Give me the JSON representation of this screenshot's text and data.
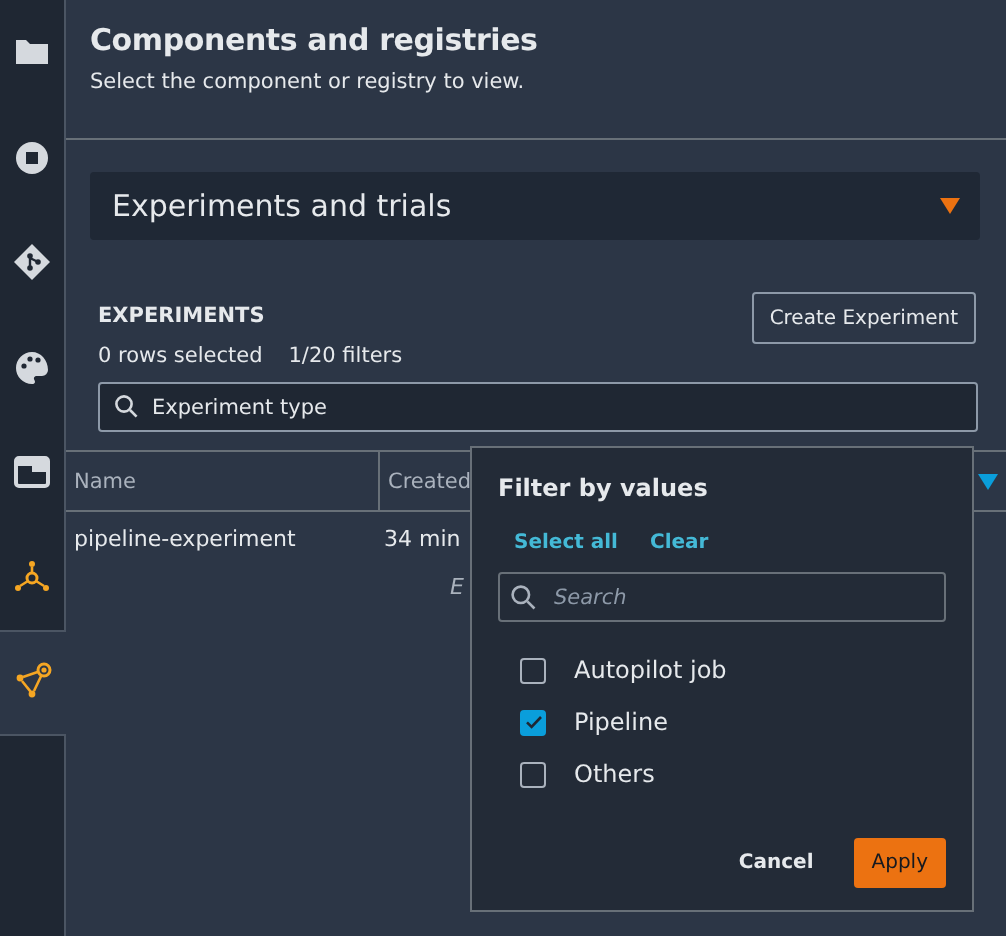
{
  "sidebar": {
    "items": [
      {
        "selected": false
      },
      {
        "selected": false
      },
      {
        "selected": false
      },
      {
        "selected": false
      },
      {
        "selected": false
      },
      {
        "selected": false
      },
      {
        "selected": true
      }
    ]
  },
  "header": {
    "title": "Components and registries",
    "subtitle": "Select the component or registry to view."
  },
  "selector": {
    "value": "Experiments and trials"
  },
  "experiments": {
    "heading": "EXPERIMENTS",
    "create_button": "Create Experiment",
    "rows_selected": "0 rows selected",
    "filters": "1/20 filters",
    "search": {
      "value": "Experiment type"
    },
    "table": {
      "columns": [
        "Name",
        "Created"
      ],
      "rows": [
        {
          "cells": [
            "pipeline-experiment",
            "34 min"
          ]
        }
      ],
      "note": "E"
    }
  },
  "filter_popup": {
    "title": "Filter by values",
    "select_all": "Select all",
    "clear": "Clear",
    "search": {
      "placeholder": "Search"
    },
    "options": [
      {
        "label": "Autopilot job",
        "checked": false
      },
      {
        "label": "Pipeline",
        "checked": true
      },
      {
        "label": "Others",
        "checked": false
      }
    ],
    "buttons": [
      {
        "label": "Cancel",
        "kind": "plain"
      },
      {
        "label": "Apply",
        "kind": "primary"
      }
    ]
  }
}
